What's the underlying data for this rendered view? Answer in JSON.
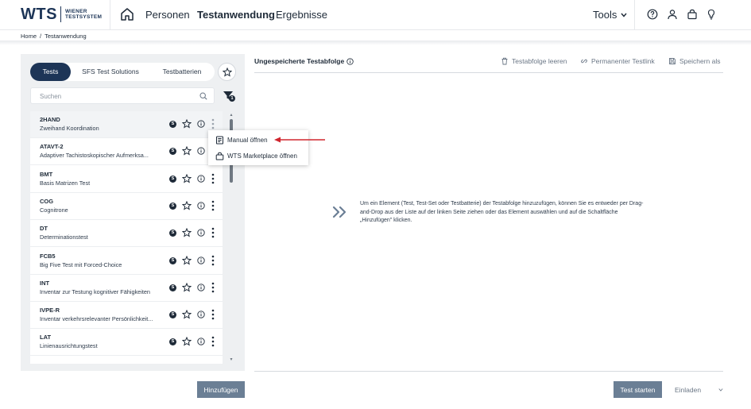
{
  "header": {
    "logo_main": "WTS",
    "logo_line1": "WIENER",
    "logo_line2": "TESTSYSTEM",
    "nav": [
      "Personen",
      "Testanwendung",
      "Ergebnisse"
    ],
    "active_nav": "Testanwendung",
    "tools_label": "Tools",
    "icons": [
      "home-icon",
      "help-icon",
      "user-icon",
      "shopping-bag-icon",
      "lightbulb-icon"
    ]
  },
  "breadcrumb": {
    "items": [
      "Home",
      "Testanwendung"
    ],
    "separator": "/"
  },
  "left": {
    "tabs": [
      "Tests",
      "SFS Test Solutions",
      "Testbatterien"
    ],
    "active_tab": "Tests",
    "search_placeholder": "Suchen",
    "filter_count": "1",
    "tests": [
      {
        "code": "2HAND",
        "name": "Zweihand Koordination"
      },
      {
        "code": "ATAVT-2",
        "name": "Adaptiver Tachistoskopischer Aufmerksa..."
      },
      {
        "code": "BMT",
        "name": "Basis Matrizen Test"
      },
      {
        "code": "COG",
        "name": "Cognitrone"
      },
      {
        "code": "DT",
        "name": "Determinationstest"
      },
      {
        "code": "FCB5",
        "name": "Big Five Test mit Forced-Choice"
      },
      {
        "code": "INT",
        "name": "Inventar zur Testung kognitiver Fähigkeiten"
      },
      {
        "code": "IVPE-R",
        "name": "Inventar verkehrsrelevanter Persönlichkeit..."
      },
      {
        "code": "LAT",
        "name": "Linienausrichtungstest"
      }
    ],
    "row_badge": "S",
    "add_button": "Hinzufügen"
  },
  "context_menu": {
    "items": [
      "Manual öffnen",
      "WTS Marketplace öffnen"
    ]
  },
  "right": {
    "title": "Ungespeicherte Testabfolge",
    "actions": [
      "Testabfolge leeren",
      "Permanenter Testlink",
      "Speichern als"
    ],
    "hint": "Um ein Element (Test, Test-Set oder Testbatterie) der Testabfolge hinzuzufügen, können Sie es entweder per Drag-and-Drop aus der Liste auf der linken Seite ziehen oder das Element auswählen und auf die Schaltfläche „Hinzufügen\" klicken.",
    "start_button": "Test starten",
    "invite_button": "Einladen"
  },
  "colors": {
    "brand": "#1d3557",
    "button": "#6b7f95",
    "annotation_arrow": "#d0262f"
  }
}
